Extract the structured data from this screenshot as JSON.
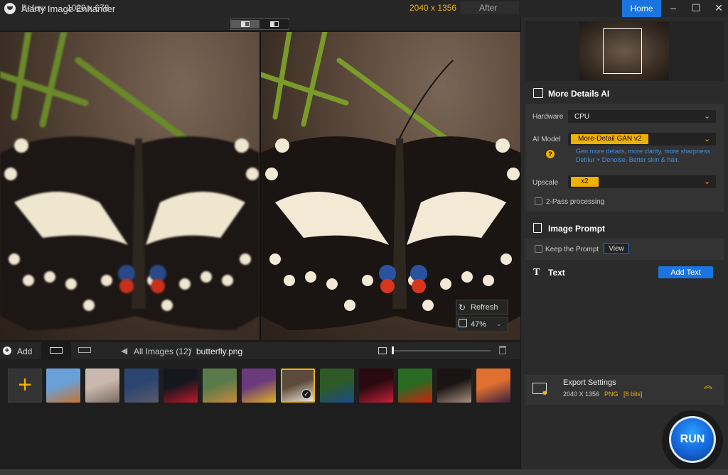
{
  "app": {
    "title": "Aiarty Image Enhancer",
    "home_label": "Home"
  },
  "viewer": {
    "before_label": "Before",
    "before_size": "1020 x 678",
    "after_size": "2040 x 1356",
    "after_label": "After",
    "refresh_label": "Refresh",
    "zoom": "47%"
  },
  "thumbbar": {
    "add_label": "Add",
    "all_images": "All Images (12)",
    "separator": "/",
    "file_name": "butterfly.png",
    "zoom_slider_fraction": 0.0
  },
  "thumbnails": [
    {
      "name": "florence",
      "colors": [
        "#6aa0d8",
        "#c8742c"
      ]
    },
    {
      "name": "woman-portrait",
      "colors": [
        "#c9b8ad",
        "#7a6a62"
      ]
    },
    {
      "name": "mountains",
      "colors": [
        "#2c4470",
        "#5a5a6a"
      ]
    },
    {
      "name": "red-rose",
      "colors": [
        "#161620",
        "#c01828"
      ]
    },
    {
      "name": "tiger",
      "colors": [
        "#5a7a4a",
        "#c88a3a"
      ]
    },
    {
      "name": "bird-flowers",
      "colors": [
        "#6a3a7a",
        "#e0b020"
      ]
    },
    {
      "name": "butterfly",
      "colors": [
        "#5c4a3c",
        "#efe6d0"
      ],
      "selected": true
    },
    {
      "name": "blue-bird",
      "colors": [
        "#2e5a26",
        "#1a4a8a"
      ]
    },
    {
      "name": "red-flowers",
      "colors": [
        "#2a0a10",
        "#c8203a"
      ]
    },
    {
      "name": "red-flower",
      "colors": [
        "#2a6a22",
        "#d02010"
      ]
    },
    {
      "name": "woman-dark",
      "colors": [
        "#1a1414",
        "#a89080"
      ]
    },
    {
      "name": "sunset-street",
      "colors": [
        "#e07030",
        "#3a2040"
      ]
    }
  ],
  "sidebar": {
    "more_details_title": "More Details AI",
    "hardware_label": "Hardware",
    "hardware_value": "CPU",
    "ai_model_label": "AI Model",
    "ai_model_value": "More-Detail GAN v2",
    "ai_model_desc_1": "Gen more details, more clarity, more sharpness.",
    "ai_model_desc_2": "Deblur + Denoise. Better skin & hair.",
    "upscale_label": "Upscale",
    "upscale_value": "x2",
    "two_pass_label": "2-Pass processing",
    "image_prompt_title": "Image Prompt",
    "keep_prompt_label": "Keep the Prompt",
    "view_label": "View",
    "text_title": "Text",
    "add_text_label": "Add Text",
    "export_title": "Export Settings",
    "export_size": "2040 X 1356",
    "export_format": "PNG",
    "export_bits": "[8 bits]",
    "run_label": "RUN"
  },
  "colors": {
    "accent": "#f0b000",
    "blue": "#1a75e0"
  }
}
